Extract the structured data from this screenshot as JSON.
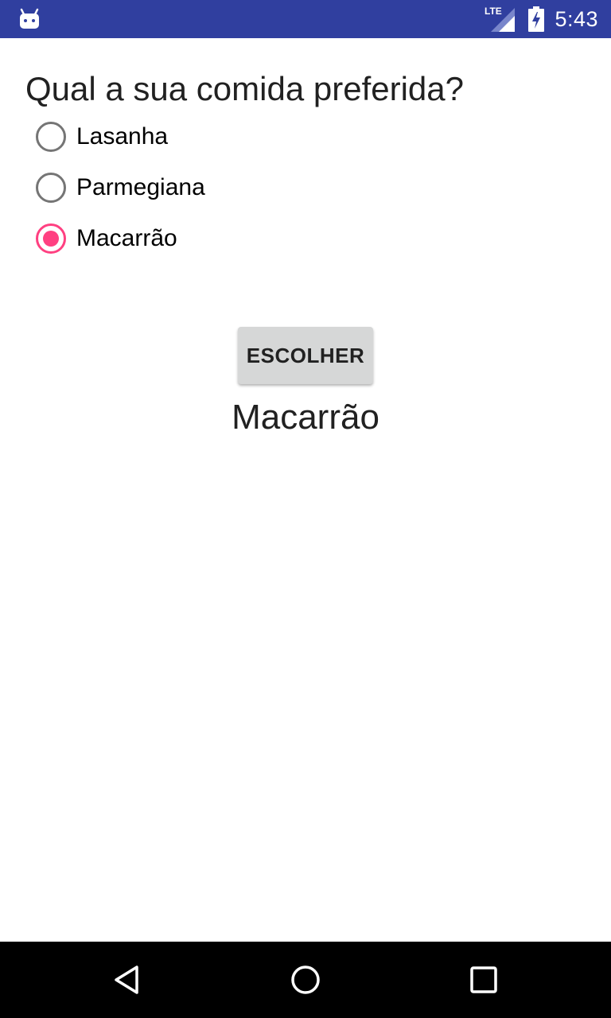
{
  "status_bar": {
    "network": "LTE",
    "time": "5:43",
    "background_color": "#303f9f"
  },
  "main": {
    "question": "Qual a sua comida preferida?",
    "options": [
      {
        "label": "Lasanha",
        "selected": false
      },
      {
        "label": "Parmegiana",
        "selected": false
      },
      {
        "label": "Macarrão",
        "selected": true
      }
    ],
    "button_label": "ESCOLHER",
    "result": "Macarrão",
    "accent_color": "#ff4081"
  },
  "nav_bar": {
    "buttons": [
      "back-icon",
      "home-icon",
      "recents-icon"
    ]
  }
}
